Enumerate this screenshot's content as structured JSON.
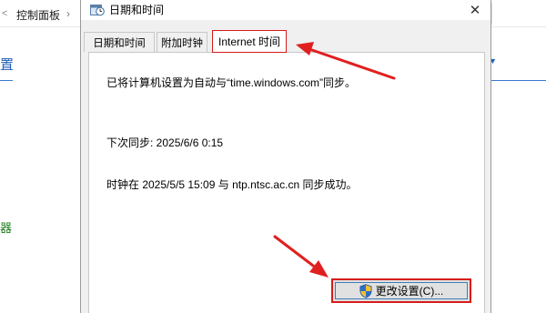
{
  "background": {
    "breadcrumb_root": "控制面板",
    "breadcrumb_separator": "›",
    "breadcrumb_next": " ",
    "back_glyph": "<",
    "side_heading": "置",
    "side_link": "器",
    "accent_color": "#1f5fb8"
  },
  "dialog": {
    "title": "日期和时间",
    "close_glyph": "✕",
    "tabs": [
      {
        "label": "日期和时间",
        "selected": false
      },
      {
        "label": "附加时钟",
        "selected": false
      },
      {
        "label": "Internet 时间",
        "selected": true
      }
    ],
    "panel": {
      "sync_info": "已将计算机设置为自动与“time.windows.com”同步。",
      "next_sync": "下次同步: 2025/6/6 0:15",
      "last_sync": "时钟在 2025/5/5 15:09 与 ntp.ntsc.ac.cn 同步成功。"
    },
    "change_button_label": "更改设置(C)..."
  },
  "annotations": {
    "highlight_color": "#d61c1c",
    "arrow_color": "#e02020"
  }
}
